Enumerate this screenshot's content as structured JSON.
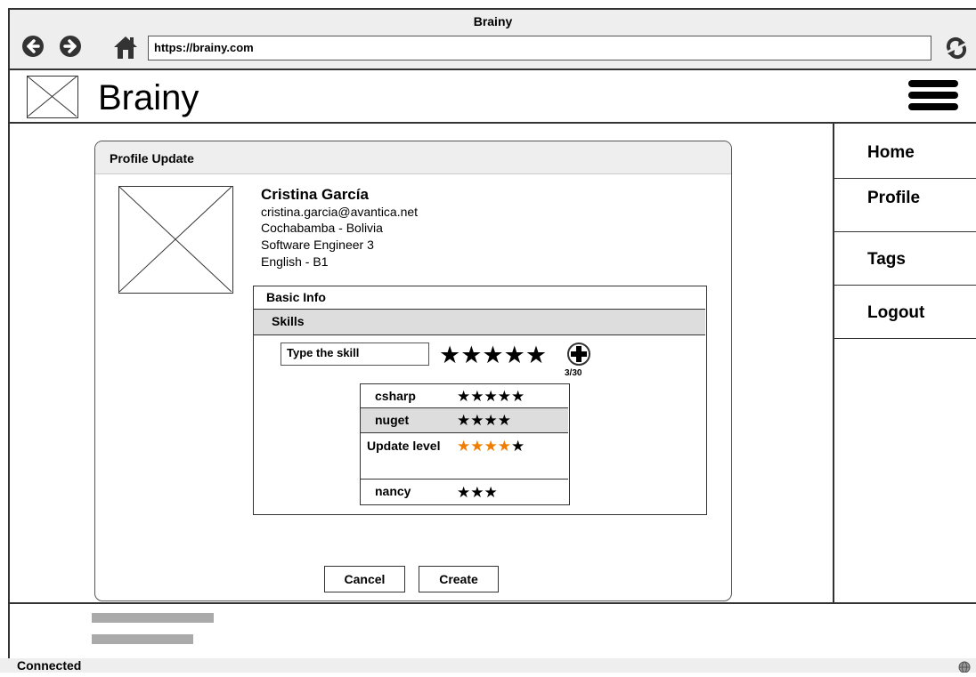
{
  "window": {
    "title": "Brainy"
  },
  "browser": {
    "url": "https://brainy.com"
  },
  "header": {
    "brand": "Brainy"
  },
  "nav": {
    "items": [
      "Home",
      "Profile",
      "Tags",
      "Logout"
    ]
  },
  "dialog": {
    "title": "Profile Update",
    "profile": {
      "name": "Cristina García",
      "email": "cristina.garcia@avantica.net",
      "location": "Cochabamba - Bolivia",
      "role": "Software Engineer 3",
      "language": "English - B1"
    },
    "tabs": {
      "basic": "Basic Info",
      "skills": "Skills"
    },
    "skill_input": {
      "placeholder": "Type the skill",
      "stars": "★★★★★",
      "rating": 5
    },
    "skill_count": "3/30",
    "skills": [
      {
        "name": "csharp",
        "stars": "★★★★★",
        "rating": 5
      },
      {
        "name": "nuget",
        "stars": "★★★★",
        "rating": 4
      },
      {
        "name": "Update level",
        "stars_highlighted": "★★★★",
        "stars_rest": "★",
        "rating": 4
      },
      {
        "name": "nancy",
        "stars": "★★★",
        "rating": 3
      }
    ],
    "buttons": {
      "cancel": "Cancel",
      "create": "Create"
    }
  },
  "status": {
    "text": "Connected"
  },
  "colors": {
    "highlight_star": "#f07d00",
    "selected_row": "#dddddd"
  }
}
